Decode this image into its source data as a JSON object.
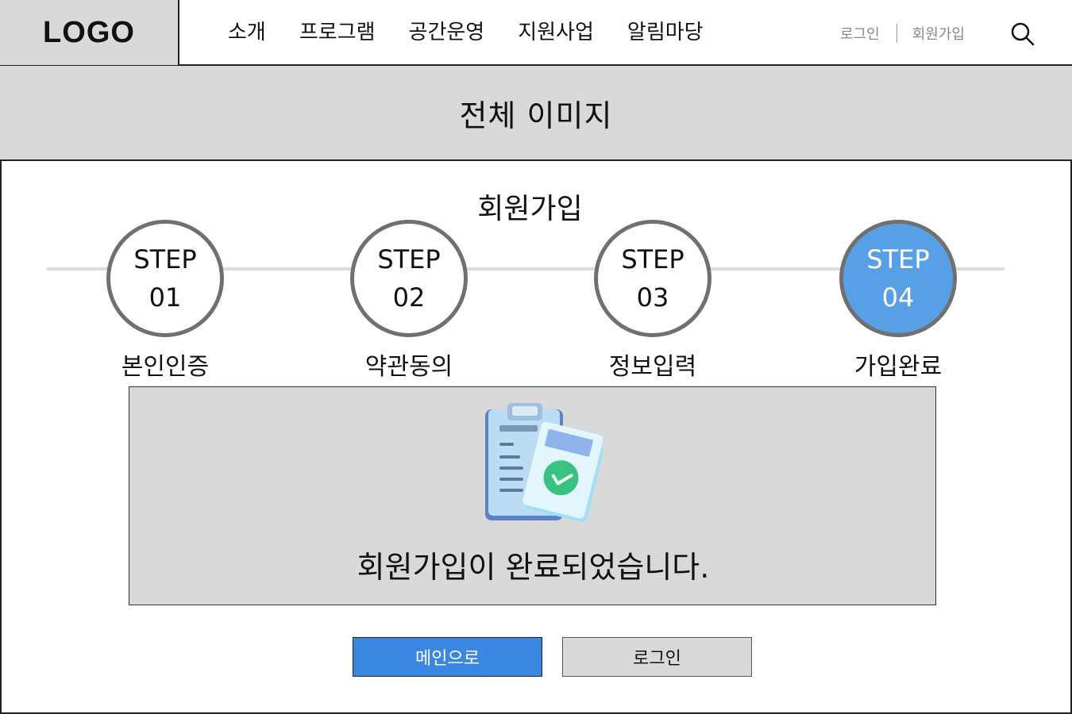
{
  "header": {
    "logo": "LOGO",
    "nav": [
      "소개",
      "프로그램",
      "공간운영",
      "지원사업",
      "알림마당"
    ],
    "auth": {
      "login": "로그인",
      "signup": "회원가입"
    },
    "search_icon": "search-icon"
  },
  "hero": {
    "text": "전체 이미지"
  },
  "page": {
    "title": "회원가입"
  },
  "steps": [
    {
      "word": "STEP",
      "num": "01",
      "label": "본인인증",
      "active": false
    },
    {
      "word": "STEP",
      "num": "02",
      "label": "약관동의",
      "active": false
    },
    {
      "word": "STEP",
      "num": "03",
      "label": "정보입력",
      "active": false
    },
    {
      "word": "STEP",
      "num": "04",
      "label": "가입완료",
      "active": true
    }
  ],
  "complete": {
    "icon": "clipboard-check-icon",
    "message": "회원가입이 완료되었습니다."
  },
  "buttons": {
    "main": "메인으로",
    "login": "로그인"
  },
  "colors": {
    "active_step": "#58a0e6",
    "primary_button": "#3a87e2",
    "placeholder_gray": "#d9d9d9"
  }
}
